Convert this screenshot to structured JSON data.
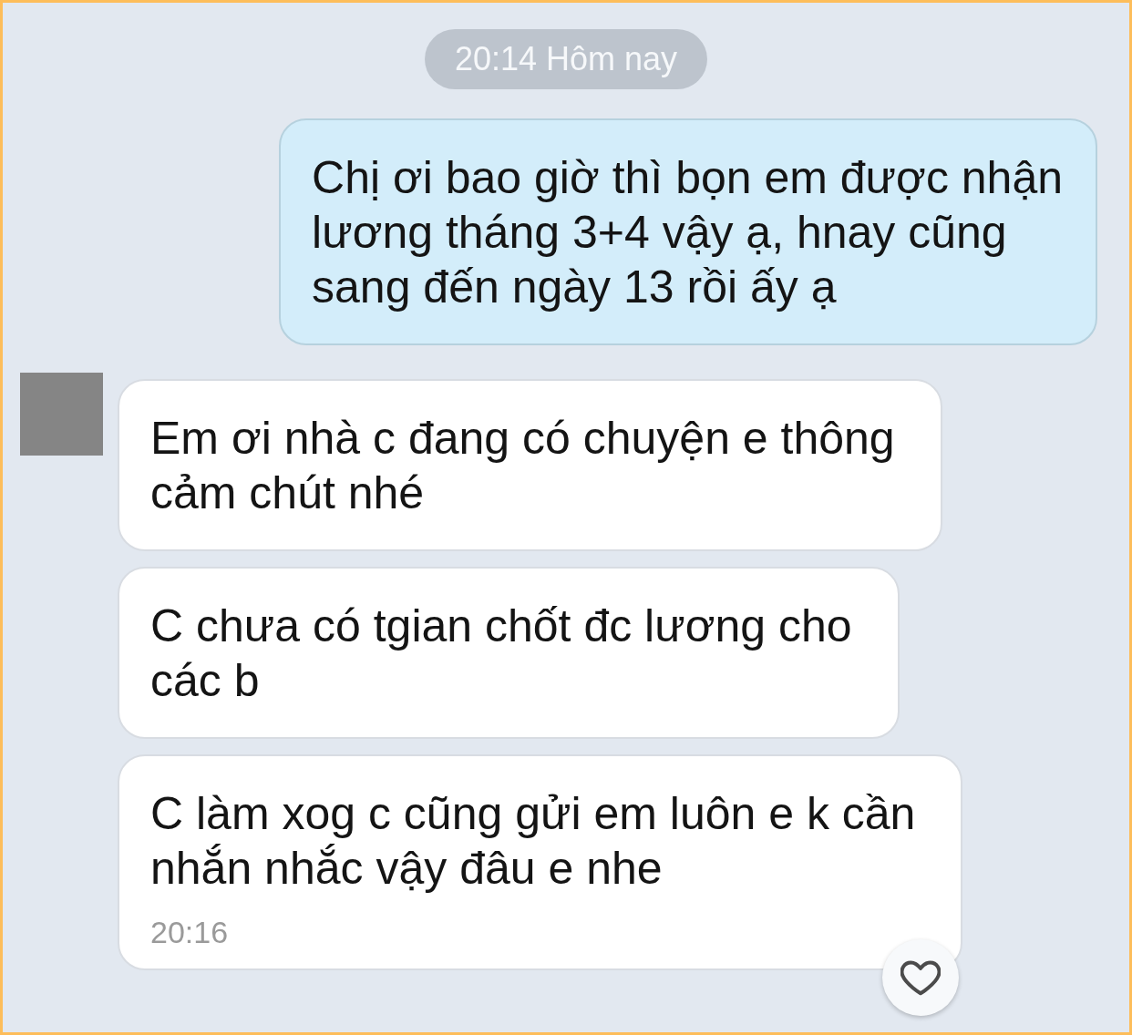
{
  "chat": {
    "time_divider": "20:14 Hôm nay",
    "messages": [
      {
        "kind": "sent",
        "text": "Chị ơi bao giờ thì bọn em được nhận\nlương tháng 3+4 vậy ạ, hnay cũng\nsang đến ngày 13 rồi ấy ạ"
      },
      {
        "kind": "received",
        "avatar": true,
        "text": "Em ơi nhà c đang có chuyện e thông\ncảm chút nhé"
      },
      {
        "kind": "received",
        "avatar": false,
        "text": "C chưa có tgian chốt đc lương cho\ncác b"
      },
      {
        "kind": "received",
        "avatar": false,
        "text": "C làm xog c cũng gửi em luôn e k cần\nnhắn nhắc vậy đâu e nhe",
        "time": "20:16",
        "reaction": {
          "liked": false
        }
      }
    ]
  }
}
